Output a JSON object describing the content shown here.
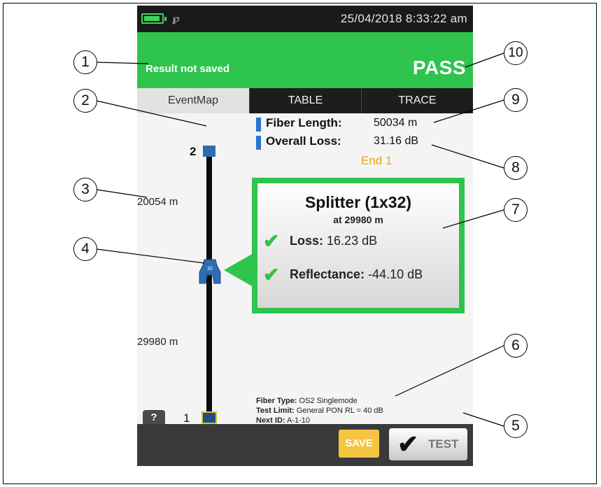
{
  "status_bar": {
    "datetime": "25/04/2018 8:33:22 am"
  },
  "result_bar": {
    "save_state": "Result not saved",
    "verdict": "PASS"
  },
  "tabs": [
    {
      "label": "EventMap",
      "active": true
    },
    {
      "label": "TABLE",
      "active": false
    },
    {
      "label": "TRACE",
      "active": false
    }
  ],
  "event_map": {
    "end_top_number": "2",
    "end_bottom_number": "1",
    "distance_top": "20054 m",
    "distance_bottom": "29980 m",
    "help_label": "?"
  },
  "summary": {
    "fiber_length_label": "Fiber Length:",
    "fiber_length_value": "50034 m",
    "overall_loss_label": "Overall Loss:",
    "overall_loss_value": "31.16 dB",
    "end_label": "End 1"
  },
  "event": {
    "title": "Splitter (1x32)",
    "subtitle": "at 29980 m",
    "loss_label": "Loss:",
    "loss_value": "16.23 dB",
    "reflectance_label": "Reflectance:",
    "reflectance_value": "-44.10 dB"
  },
  "fiber_info": {
    "fiber_type_label": "Fiber Type:",
    "fiber_type_value": "OS2 Singlemode",
    "test_limit_label": "Test Limit:",
    "test_limit_value": "General PON RL = 40 dB",
    "next_id_label": "Next ID:",
    "next_id_value": "A-1-10"
  },
  "bottom_bar": {
    "save_label": "SAVE",
    "test_label": "TEST"
  },
  "callouts": [
    "1",
    "2",
    "3",
    "4",
    "5",
    "6",
    "7",
    "8",
    "9",
    "10"
  ],
  "colors": {
    "accent_green": "#2ec44e",
    "pass_text": "#ffffff",
    "end_label": "#f0a020",
    "save_button": "#f4c542"
  }
}
